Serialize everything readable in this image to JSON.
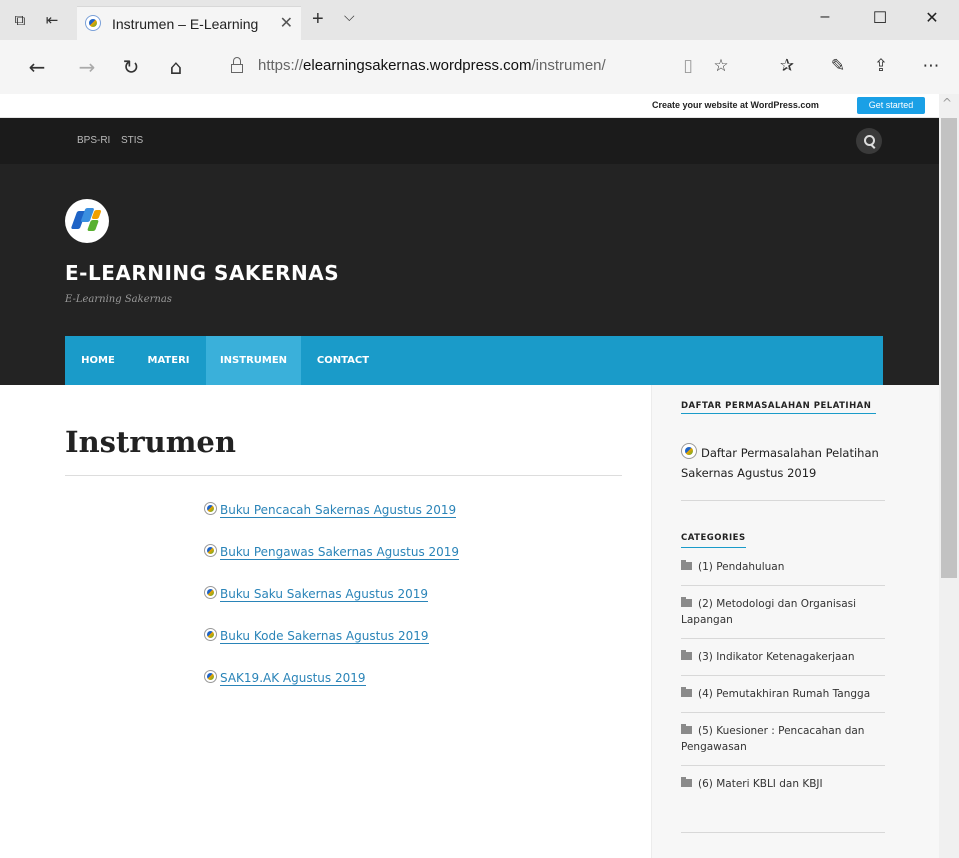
{
  "browser": {
    "tab_title": "Instrumen – E-Learning",
    "url_prefix": "https://",
    "url_domain": "elearningsakernas.wordpress.com",
    "url_path": "/instrumen/"
  },
  "wp_bar": {
    "create_text": "Create your website at WordPress.com",
    "get_started": "Get started"
  },
  "top_nav": [
    "BPS-RI",
    "STIS"
  ],
  "site": {
    "title": "E-LEARNING SAKERNAS",
    "description": "E-Learning Sakernas"
  },
  "main_nav": [
    "HOME",
    "MATERI",
    "INSTRUMEN",
    "CONTACT"
  ],
  "page": {
    "title": "Instrumen",
    "links": [
      "Buku Pencacah Sakernas Agustus 2019",
      "Buku Pengawas Sakernas Agustus 2019",
      "Buku Saku Sakernas Agustus 2019",
      "Buku Kode Sakernas Agustus 2019",
      "SAK19.AK Agustus 2019"
    ]
  },
  "sidebar": {
    "widget1_title": "DAFTAR PERMASALAHAN PELATIHAN",
    "widget1_link": "Daftar Permasalahan Pelatihan Sakernas Agustus 2019",
    "categories_title": "CATEGORIES",
    "categories": [
      "(1) Pendahuluan",
      "(2) Metodologi dan Organisasi Lapangan",
      "(3) Indikator Ketenagakerjaan",
      "(4) Pemutakhiran Rumah Tangga",
      "(5) Kuesioner : Pencacahan dan Pengawasan",
      "(6) Materi KBLI dan KBJI"
    ]
  },
  "colors": {
    "accent": "#1a9bc9",
    "header_bg": "#232323",
    "link": "#2a84b8",
    "wp_button": "#1aa0e6"
  }
}
